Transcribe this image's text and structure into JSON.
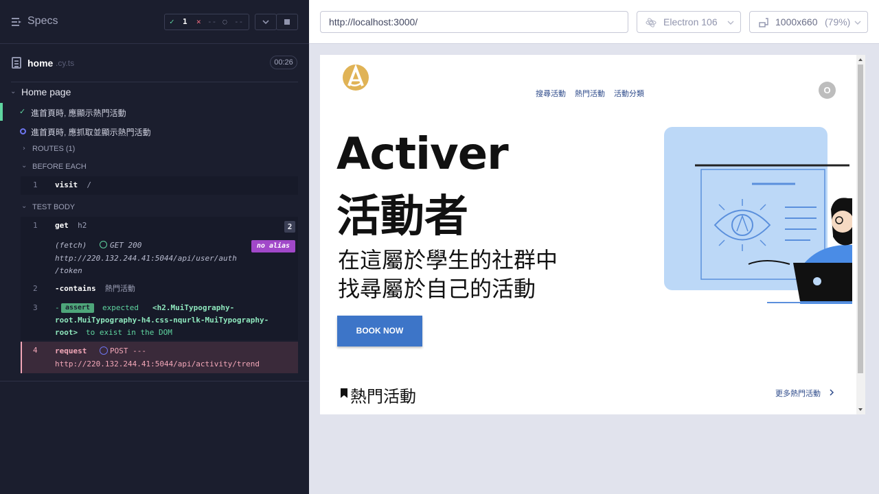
{
  "reporter": {
    "header": {
      "specs_label": "Specs",
      "stats": {
        "passed": "1",
        "failed": "--",
        "pending": "--"
      },
      "controls": [
        "chevron-down-icon",
        "stop-icon"
      ]
    },
    "spec": {
      "name": "home",
      "ext": ".cy.ts",
      "duration": "00:26"
    },
    "suite": {
      "title": "Home page",
      "tests": [
        {
          "title": "進首頁時, 應顯示熱門活動",
          "state": "passed"
        },
        {
          "title": "進首頁時, 應抓取並顯示熱門活動",
          "state": "running"
        }
      ]
    },
    "sections": {
      "routes": "ROUTES (1)",
      "before_each": "BEFORE EACH",
      "test_body": "TEST BODY"
    },
    "before_each_cmds": [
      {
        "num": "1",
        "name": "visit",
        "arg": "/"
      }
    ],
    "test_body_cmds": {
      "c1": {
        "num": "1",
        "name": "get",
        "arg": "h2",
        "count": "2"
      },
      "fetch": {
        "prefix": "(fetch)",
        "status": "GET 200",
        "alias": "no alias",
        "url1": "http://220.132.244.41:5044/api/user/auth",
        "url2": "/token"
      },
      "c2": {
        "num": "2",
        "prefix": "-",
        "name": "contains",
        "arg": "熱門活動"
      },
      "c3": {
        "num": "3",
        "prefix": "-",
        "badge": "assert",
        "expected": "expected",
        "line1": "<h2.MuiTypography-",
        "line2": "root.MuiTypography-h4.css-nqurlk-MuiTypography-",
        "line3_code": "root>",
        "line3_rest": "to exist in the DOM"
      },
      "c4": {
        "num": "4",
        "name": "request",
        "method": "POST ---",
        "url": "http://220.132.244.41:5044/api/activity/trend"
      }
    }
  },
  "aut": {
    "url": "http://localhost:3000/",
    "browser": "Electron 106",
    "viewport": "1000x660",
    "zoom": "(79%)"
  },
  "app": {
    "nav": [
      "搜尋活動",
      "熱門活動",
      "活動分類"
    ],
    "avatar_letter": "O",
    "hero_title_1": "Activer",
    "hero_title_2": "活動者",
    "hero_sub_1": "在這屬於學生的社群中",
    "hero_sub_2": "找尋屬於自己的活動",
    "cta": "BOOK NOW",
    "section_title": "熱門活動",
    "more_link": "更多熱門活動"
  },
  "colors": {
    "reporter_bg": "#1b1e2e",
    "passed": "#5fd5a0",
    "failed": "#f16b7e",
    "running": "#6e76f1",
    "cta": "#3d75c8",
    "illustration_bg": "#bcd8f7"
  }
}
